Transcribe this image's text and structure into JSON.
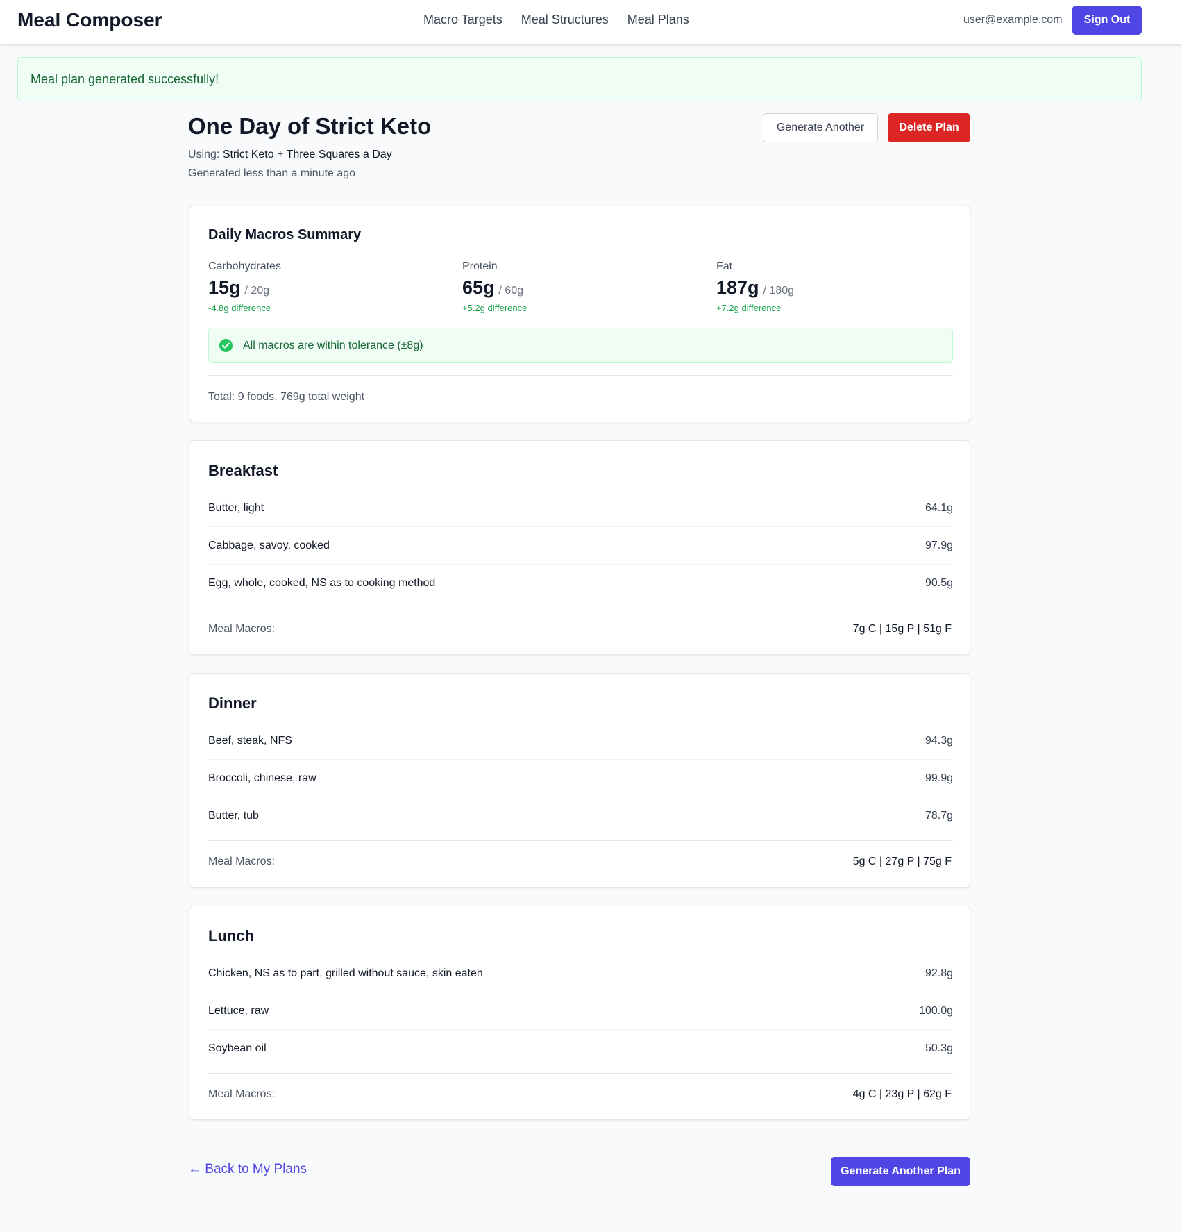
{
  "nav": {
    "brand": "Meal Composer",
    "links": [
      "Macro Targets",
      "Meal Structures",
      "Meal Plans"
    ],
    "user_email": "user@example.com",
    "sign_out": "Sign Out"
  },
  "alert": {
    "message": "Meal plan generated successfully!"
  },
  "plan": {
    "title": "One Day of Strict Keto",
    "using_prefix": "Using:",
    "macro_target": "Strict Keto",
    "plus": "+",
    "structure": "Three Squares a Day",
    "generated": "Generated less than a minute ago",
    "generate_another": "Generate Another",
    "delete": "Delete Plan"
  },
  "summary": {
    "title": "Daily Macros Summary",
    "macros": [
      {
        "label": "Carbohydrates",
        "value": "15g",
        "target": "/ 20g",
        "diff": "-4.8g difference"
      },
      {
        "label": "Protein",
        "value": "65g",
        "target": "/ 60g",
        "diff": "+5.2g difference"
      },
      {
        "label": "Fat",
        "value": "187g",
        "target": "/ 180g",
        "diff": "+7.2g difference"
      }
    ],
    "tolerance": "All macros are within tolerance (±8g)",
    "total": "Total: 9 foods, 769g total weight"
  },
  "meals": [
    {
      "name": "Breakfast",
      "foods": [
        {
          "name": "Butter, light",
          "weight": "64.1g"
        },
        {
          "name": "Cabbage, savoy, cooked",
          "weight": "97.9g"
        },
        {
          "name": "Egg, whole, cooked, NS as to cooking method",
          "weight": "90.5g"
        }
      ],
      "macros_label": "Meal Macros:",
      "macros": "7g C | 15g P | 51g F"
    },
    {
      "name": "Dinner",
      "foods": [
        {
          "name": "Beef, steak, NFS",
          "weight": "94.3g"
        },
        {
          "name": "Broccoli, chinese, raw",
          "weight": "99.9g"
        },
        {
          "name": "Butter, tub",
          "weight": "78.7g"
        }
      ],
      "macros_label": "Meal Macros:",
      "macros": "5g C | 27g P | 75g F"
    },
    {
      "name": "Lunch",
      "foods": [
        {
          "name": "Chicken, NS as to part, grilled without sauce, skin eaten",
          "weight": "92.8g"
        },
        {
          "name": "Lettuce, raw",
          "weight": "100.0g"
        },
        {
          "name": "Soybean oil",
          "weight": "50.3g"
        }
      ],
      "macros_label": "Meal Macros:",
      "macros": "4g C | 23g P | 62g F"
    }
  ],
  "footer": {
    "back_arrow": "←",
    "back": "Back to My Plans",
    "generate_another_plan": "Generate Another Plan"
  },
  "colors": {
    "primary": "#4f46e5",
    "danger": "#dc2626",
    "success": "#16a34a",
    "success_bg": "#f0fdf4"
  }
}
